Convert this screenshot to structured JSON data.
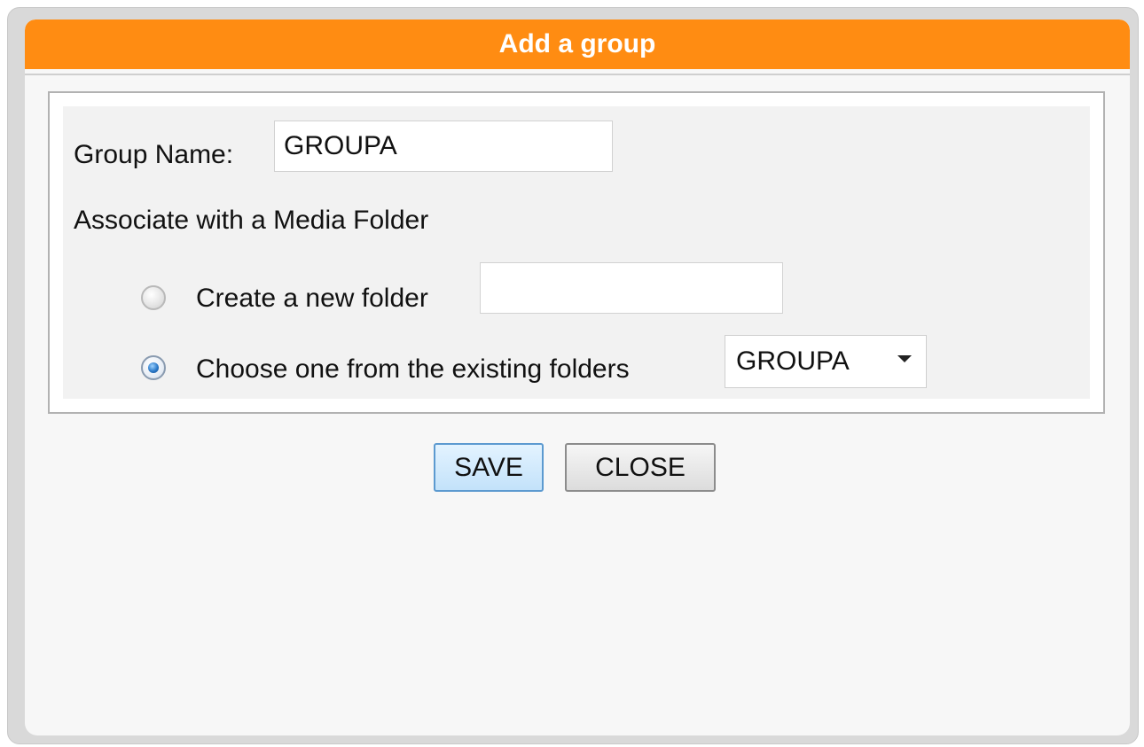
{
  "dialog": {
    "title": "Add a group"
  },
  "form": {
    "group_name_label": "Group Name:",
    "group_name_value": "GROUPA",
    "associate_label": "Associate with a Media Folder",
    "option_new_label": "Create a new folder",
    "option_new_value": "",
    "option_existing_label": "Choose one from the existing folders",
    "existing_folder_selected": "GROUPA",
    "selected_option": "existing"
  },
  "buttons": {
    "save_label": "SAVE",
    "close_label": "CLOSE"
  },
  "colors": {
    "title_bar": "#ff8c12",
    "title_text": "#ffffff",
    "save_border": "#5c9ad0"
  }
}
